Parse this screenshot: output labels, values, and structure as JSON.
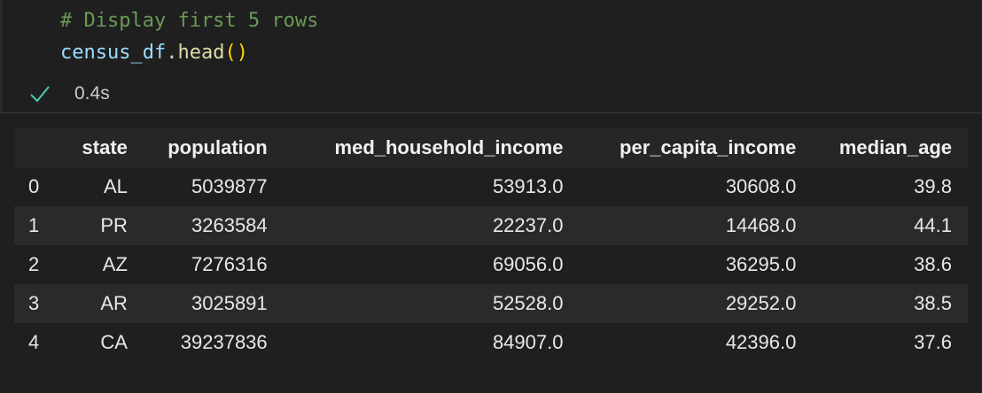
{
  "code": {
    "comment": "# Display first 5 rows",
    "variable": "census_df",
    "dot": ".",
    "method": "head",
    "parens": "()"
  },
  "status": {
    "icon": "check-icon",
    "exec_time": "0.4s"
  },
  "table": {
    "index_header": "",
    "columns": [
      "state",
      "population",
      "med_household_income",
      "per_capita_income",
      "median_age"
    ],
    "rows": [
      {
        "index": "0",
        "values": [
          "AL",
          "5039877",
          "53913.0",
          "30608.0",
          "39.8"
        ]
      },
      {
        "index": "1",
        "values": [
          "PR",
          "3263584",
          "22237.0",
          "14468.0",
          "44.1"
        ]
      },
      {
        "index": "2",
        "values": [
          "AZ",
          "7276316",
          "69056.0",
          "36295.0",
          "38.6"
        ]
      },
      {
        "index": "3",
        "values": [
          "AR",
          "3025891",
          "52528.0",
          "29252.0",
          "38.5"
        ]
      },
      {
        "index": "4",
        "values": [
          "CA",
          "39237836",
          "84907.0",
          "42396.0",
          "37.6"
        ]
      }
    ]
  },
  "colors": {
    "background": "#1f1f1f",
    "comment": "#6a9955",
    "variable": "#9cdcfe",
    "method": "#dcdcaa",
    "paren": "#ffd700",
    "success": "#4ec9b0"
  }
}
